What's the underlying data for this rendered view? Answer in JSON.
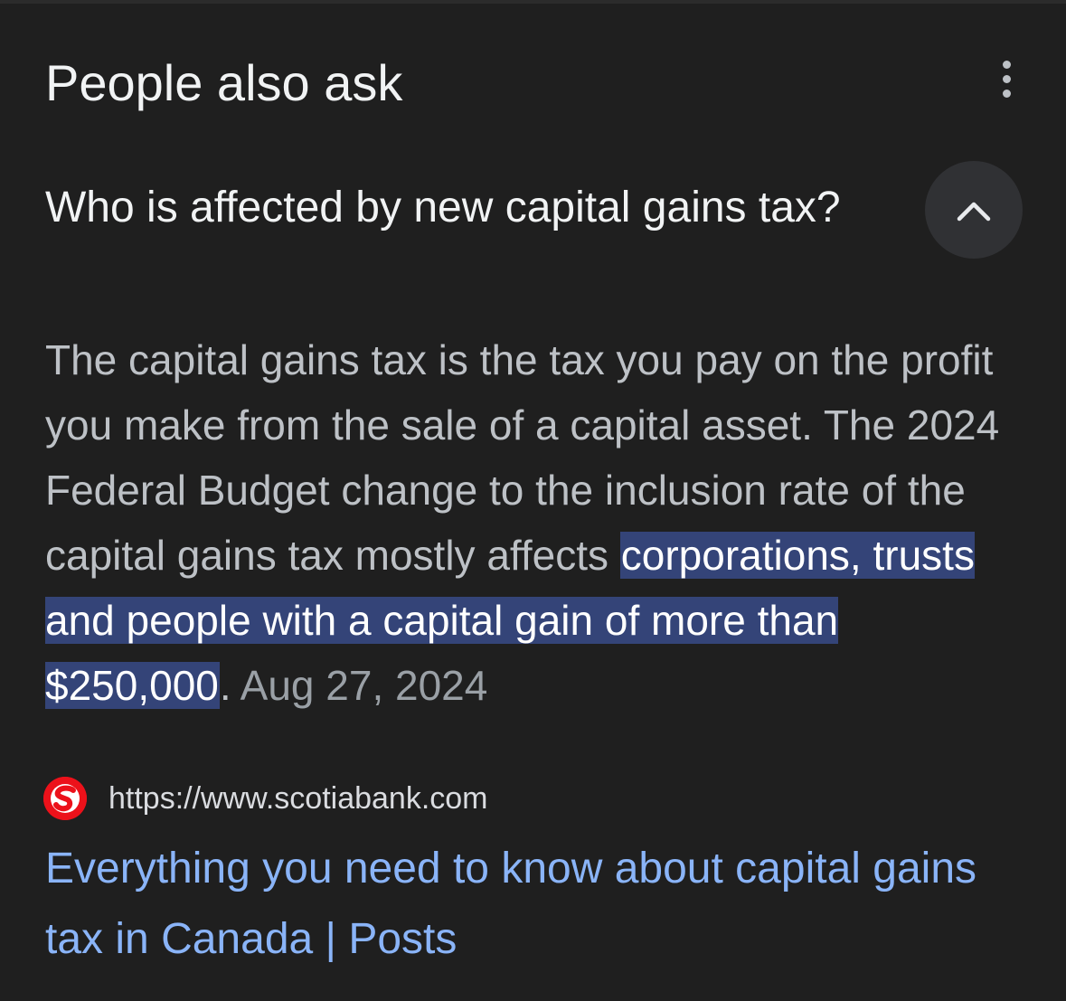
{
  "section": {
    "title": "People also ask",
    "more_icon": "more-vert-icon"
  },
  "question": {
    "text": "Who is affected by new capital gains tax?",
    "toggle_icon": "chevron-up-icon",
    "expanded": true
  },
  "answer": {
    "text_before": "The capital gains tax is the tax you pay on the profit you make from the sale of a capital asset. The 2024 Federal Budget change to the inclusion rate of the capital gains tax mostly affects ",
    "highlight": "corporations, trusts and people with a capital gain of more than $250,000",
    "text_after": ".",
    "date": "Aug 27, 2024",
    "highlight_color": "#344478"
  },
  "source": {
    "favicon": "scotiabank-logo-icon",
    "url": "https://www.scotiabank.com",
    "title": "Everything you need to know about capital gains tax in Canada | Posts"
  },
  "colors": {
    "background": "#1f1f1f",
    "link": "#8ab4f8",
    "brand_red": "#ec111a"
  }
}
